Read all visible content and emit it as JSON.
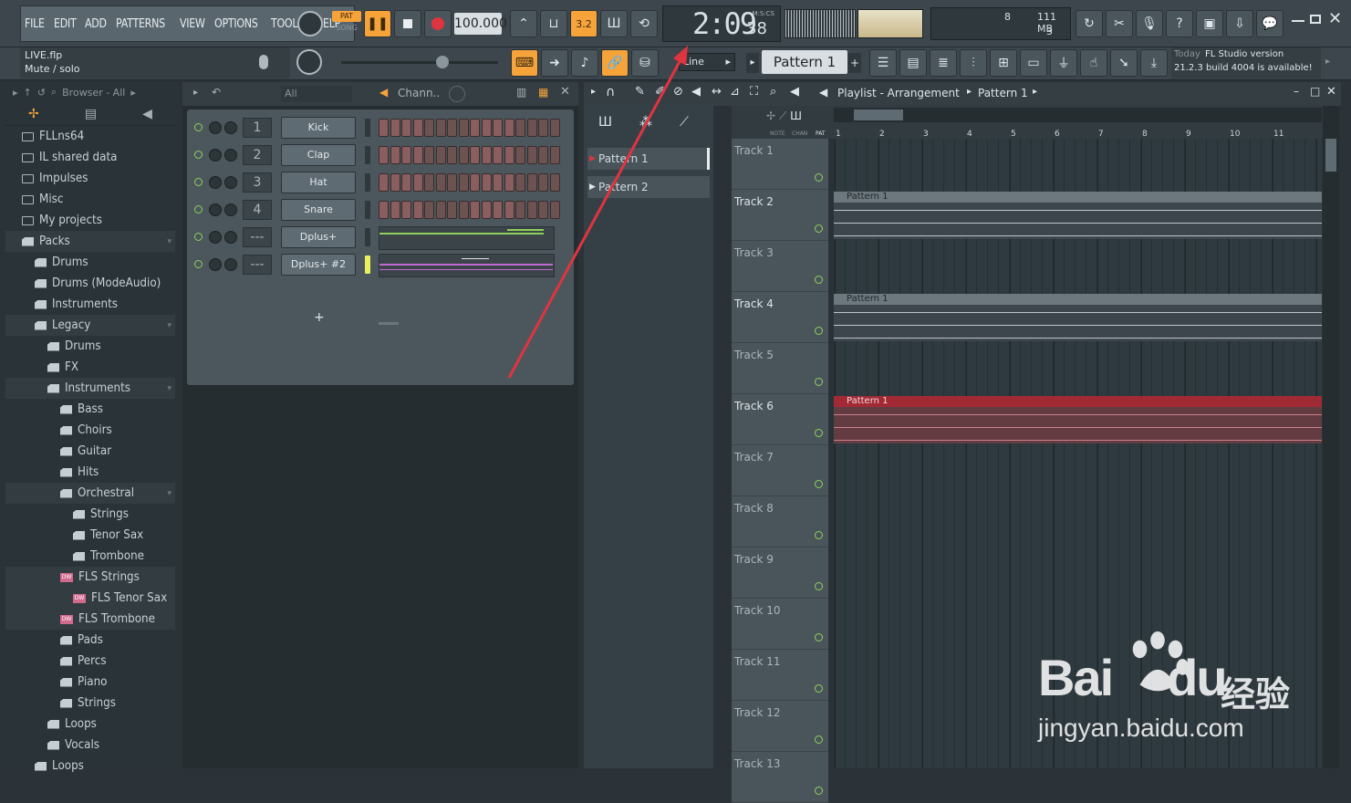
{
  "menu": [
    "FILE",
    "EDIT",
    "ADD",
    "PATTERNS",
    "VIEW",
    "OPTIONS",
    "TOOLS",
    "HELP"
  ],
  "transport": {
    "pat_label": "PAT",
    "song_label": "SONG",
    "tempo": "100.000",
    "time": "2:09",
    "time_small": "38",
    "time_mode": "M:S:CS"
  },
  "monitor": {
    "cpu": "8",
    "ram": "111 MB",
    "voices": "3"
  },
  "hint": {
    "file": "LIVE.flp",
    "text": "Mute / solo"
  },
  "snap": "Line",
  "pattern_selector": "Pattern 1",
  "news": {
    "day": "Today",
    "title": "FL Studio version",
    "text": "21.2.3 build 4004 is available!"
  },
  "browser": {
    "title": "Browser - All",
    "items": [
      {
        "label": "FLLns64",
        "type": "folder",
        "indent": 0
      },
      {
        "label": "IL shared data",
        "type": "folder",
        "indent": 0
      },
      {
        "label": "Impulses",
        "type": "folder",
        "indent": 0
      },
      {
        "label": "Misc",
        "type": "folder",
        "indent": 0
      },
      {
        "label": "My projects",
        "type": "folder",
        "indent": 0
      },
      {
        "label": "Packs",
        "type": "pack",
        "indent": 0,
        "open": true
      },
      {
        "label": "Drums",
        "type": "pack",
        "indent": 1
      },
      {
        "label": "Drums (ModeAudio)",
        "type": "pack",
        "indent": 1
      },
      {
        "label": "Instruments",
        "type": "pack",
        "indent": 1
      },
      {
        "label": "Legacy",
        "type": "pack",
        "indent": 1,
        "open": true
      },
      {
        "label": "Drums",
        "type": "pack",
        "indent": 2
      },
      {
        "label": "FX",
        "type": "pack",
        "indent": 2
      },
      {
        "label": "Instruments",
        "type": "pack",
        "indent": 2,
        "open": true
      },
      {
        "label": "Bass",
        "type": "pack",
        "indent": 3
      },
      {
        "label": "Choirs",
        "type": "pack",
        "indent": 3
      },
      {
        "label": "Guitar",
        "type": "pack",
        "indent": 3
      },
      {
        "label": "Hits",
        "type": "pack",
        "indent": 3
      },
      {
        "label": "Orchestral",
        "type": "pack",
        "indent": 3,
        "open": true
      },
      {
        "label": "Strings",
        "type": "pack",
        "indent": 4
      },
      {
        "label": "Tenor Sax",
        "type": "pack",
        "indent": 4
      },
      {
        "label": "Trombone",
        "type": "pack",
        "indent": 4
      },
      {
        "label": "FLS Strings",
        "type": "dw",
        "indent": 3
      },
      {
        "label": "FLS Tenor Sax",
        "type": "dw",
        "indent": 4
      },
      {
        "label": "FLS Trombone",
        "type": "dw",
        "indent": 3
      },
      {
        "label": "Pads",
        "type": "pack",
        "indent": 3
      },
      {
        "label": "Percs",
        "type": "pack",
        "indent": 3
      },
      {
        "label": "Piano",
        "type": "pack",
        "indent": 3
      },
      {
        "label": "Strings",
        "type": "pack",
        "indent": 3
      },
      {
        "label": "Loops",
        "type": "pack",
        "indent": 2
      },
      {
        "label": "Vocals",
        "type": "pack",
        "indent": 2
      },
      {
        "label": "Loops",
        "type": "pack",
        "indent": 1
      }
    ]
  },
  "rack": {
    "filter": "All",
    "title": "Chann..",
    "add": "+",
    "channels": [
      {
        "num": "1",
        "name": "Kick"
      },
      {
        "num": "2",
        "name": "Clap"
      },
      {
        "num": "3",
        "name": "Hat"
      },
      {
        "num": "4",
        "name": "Snare"
      },
      {
        "num": "---",
        "name": "Dplus+"
      },
      {
        "num": "---",
        "name": "Dplus+ #2"
      }
    ]
  },
  "playlist": {
    "title": "Playlist - Arrangement",
    "pattern": "Pattern 1",
    "header_labels": [
      "NOTE",
      "CHAN",
      "PAT"
    ],
    "patterns": [
      "Pattern 1",
      "Pattern 2"
    ],
    "ruler": [
      "1",
      "2",
      "3",
      "4",
      "5",
      "6",
      "7",
      "8",
      "9",
      "10",
      "11"
    ],
    "tracks": [
      "Track 1",
      "Track 2",
      "Track 3",
      "Track 4",
      "Track 5",
      "Track 6",
      "Track 7",
      "Track 8",
      "Track 9",
      "Track 10",
      "Track 11",
      "Track 12",
      "Track 13"
    ],
    "clips": [
      {
        "track": 2,
        "label": "Pattern 1",
        "color": "gray"
      },
      {
        "track": 4,
        "label": "Pattern 1",
        "color": "gray"
      },
      {
        "track": 6,
        "label": "Pattern 1",
        "color": "red"
      }
    ]
  },
  "watermark": {
    "brand": "Bai",
    "brand_du": "du",
    "cn": "经验",
    "url": "jingyan.baidu.com"
  }
}
